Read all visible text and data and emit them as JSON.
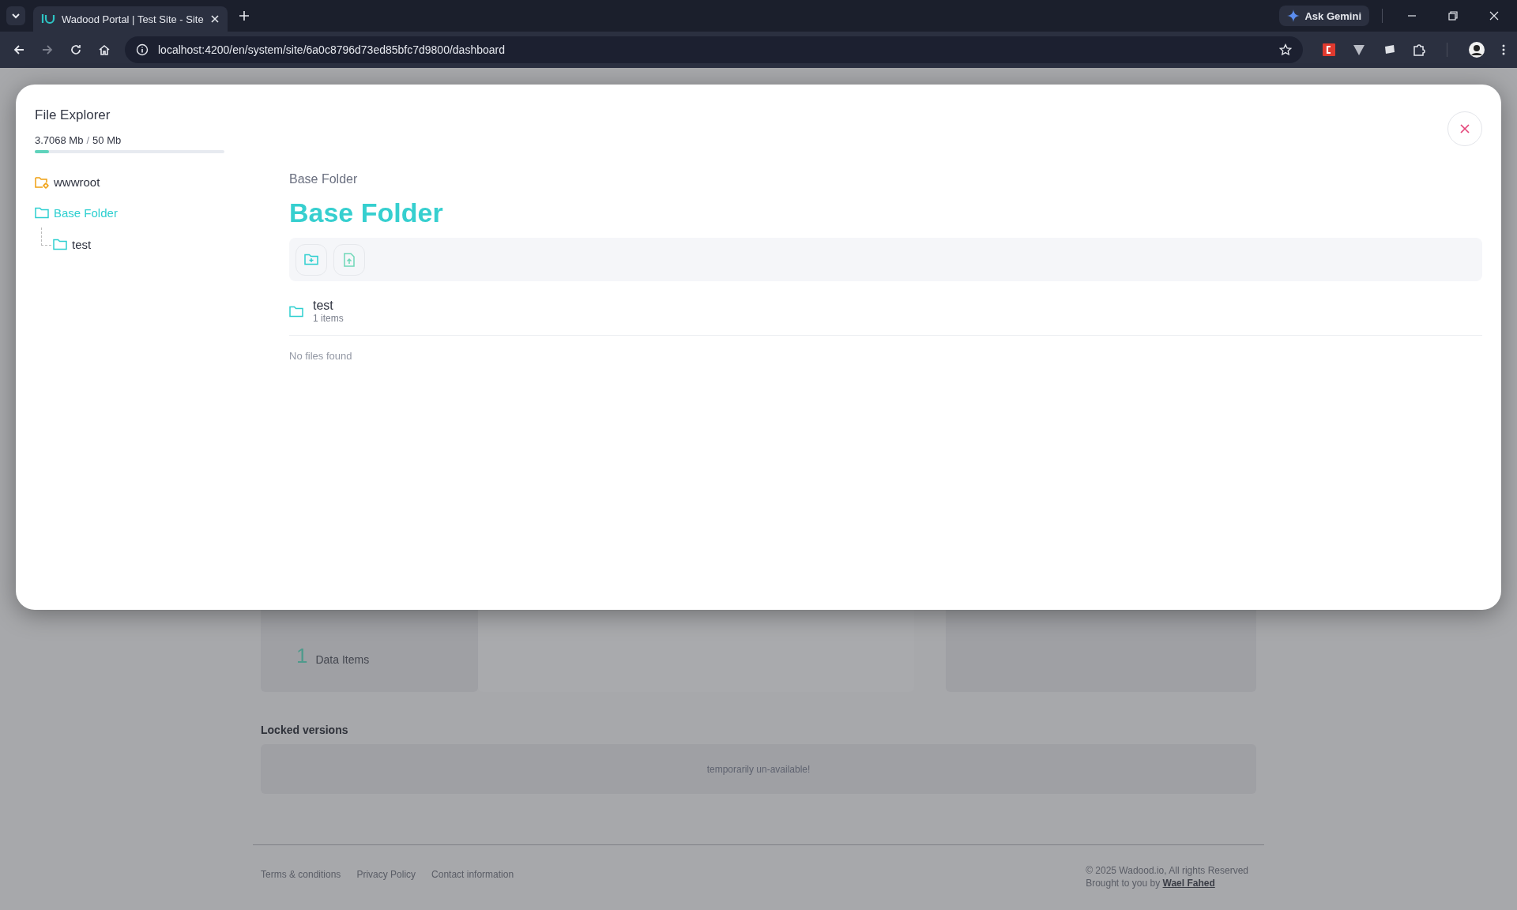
{
  "browser": {
    "tabs": [
      {
        "title": "Wadood Portal | Test Site - Site",
        "selected": true
      }
    ],
    "address": "localhost:4200/en/system/site/6a0c8796d73ed85bfc7d9800/dashboard",
    "assistant_button": "Ask Gemini"
  },
  "modal": {
    "title": "File Explorer",
    "storage": {
      "used": "3.7068 Mb",
      "separator": "/",
      "total": "50 Mb",
      "level": 0.074
    },
    "tree": [
      {
        "name": "wwwroot",
        "kind": "root",
        "selected": false
      },
      {
        "name": "Base Folder",
        "kind": "folder",
        "selected": true,
        "expanded": true,
        "children": [
          {
            "name": "test",
            "kind": "folder",
            "selected": false
          }
        ]
      }
    ],
    "breadcrumb": "Base Folder",
    "heading": "Base Folder",
    "folders": [
      {
        "name": "test",
        "count": "1 items"
      }
    ],
    "empty_message": "No files found"
  },
  "background_page": {
    "stat": {
      "value": "1",
      "label": "Data Items"
    },
    "locked_versions": {
      "title": "Locked versions",
      "message": "temporarily un-available!"
    },
    "footer": {
      "links": [
        "Terms & conditions",
        "Privacy Policy",
        "Contact information"
      ],
      "copyright": "© 2025 Wadood.io, All rights Reserved",
      "credit_prefix": "Brought to you by",
      "credit_link": "Wael Fahed"
    }
  }
}
